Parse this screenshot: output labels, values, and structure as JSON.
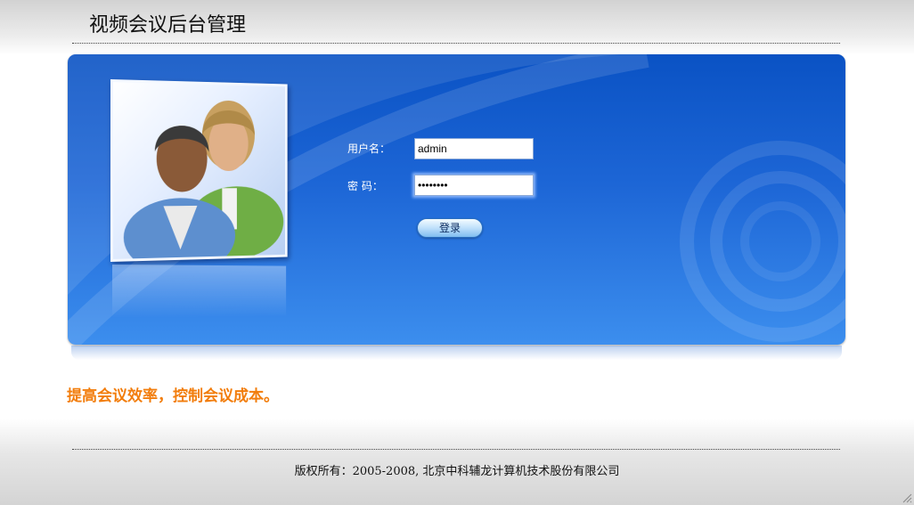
{
  "header": {
    "title": "视频会议后台管理"
  },
  "login": {
    "username_label": "用户名：",
    "username_value": "admin",
    "password_label": "密  码：",
    "password_value": "••••••••",
    "submit_label": "登录",
    "illustration_icon": "users-icon"
  },
  "slogan": "提高会议效率，控制会议成本。",
  "footer": {
    "copyright": "版权所有：2005-2008, 北京中科辅龙计算机技术股份有限公司"
  },
  "colors": {
    "panel_top": "#0a52c4",
    "panel_bottom": "#3c8eee",
    "slogan": "#f27d0c",
    "button_light": "#bfe0fb"
  }
}
